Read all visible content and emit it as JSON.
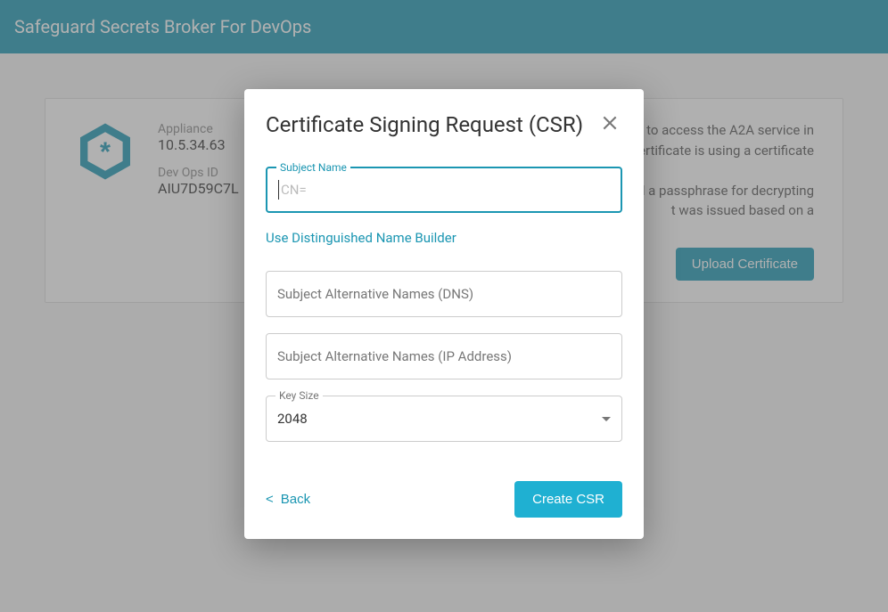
{
  "header": {
    "title": "Safeguard Secrets Broker For DevOps"
  },
  "card": {
    "appliance_label": "Appliance",
    "appliance_value": "10.5.34.63",
    "devops_label": "Dev Ops ID",
    "devops_value": "AIU7D59C7L",
    "desc1": "to access the A2A service in",
    "desc2": "ertificate is using a certificate",
    "desc3": "and a passphrase for decrypting",
    "desc4": "t was issued based on a",
    "upload_btn": "Upload Certificate"
  },
  "dialog": {
    "title": "Certificate Signing Request (CSR)",
    "subject_name_label": "Subject Name",
    "subject_name_placeholder": "CN=",
    "dn_builder_link": "Use Distinguished Name Builder",
    "san_dns_placeholder": "Subject Alternative Names (DNS)",
    "san_ip_placeholder": "Subject Alternative Names (IP Address)",
    "key_size_label": "Key Size",
    "key_size_value": "2048",
    "back_label": "Back",
    "create_label": "Create CSR"
  }
}
